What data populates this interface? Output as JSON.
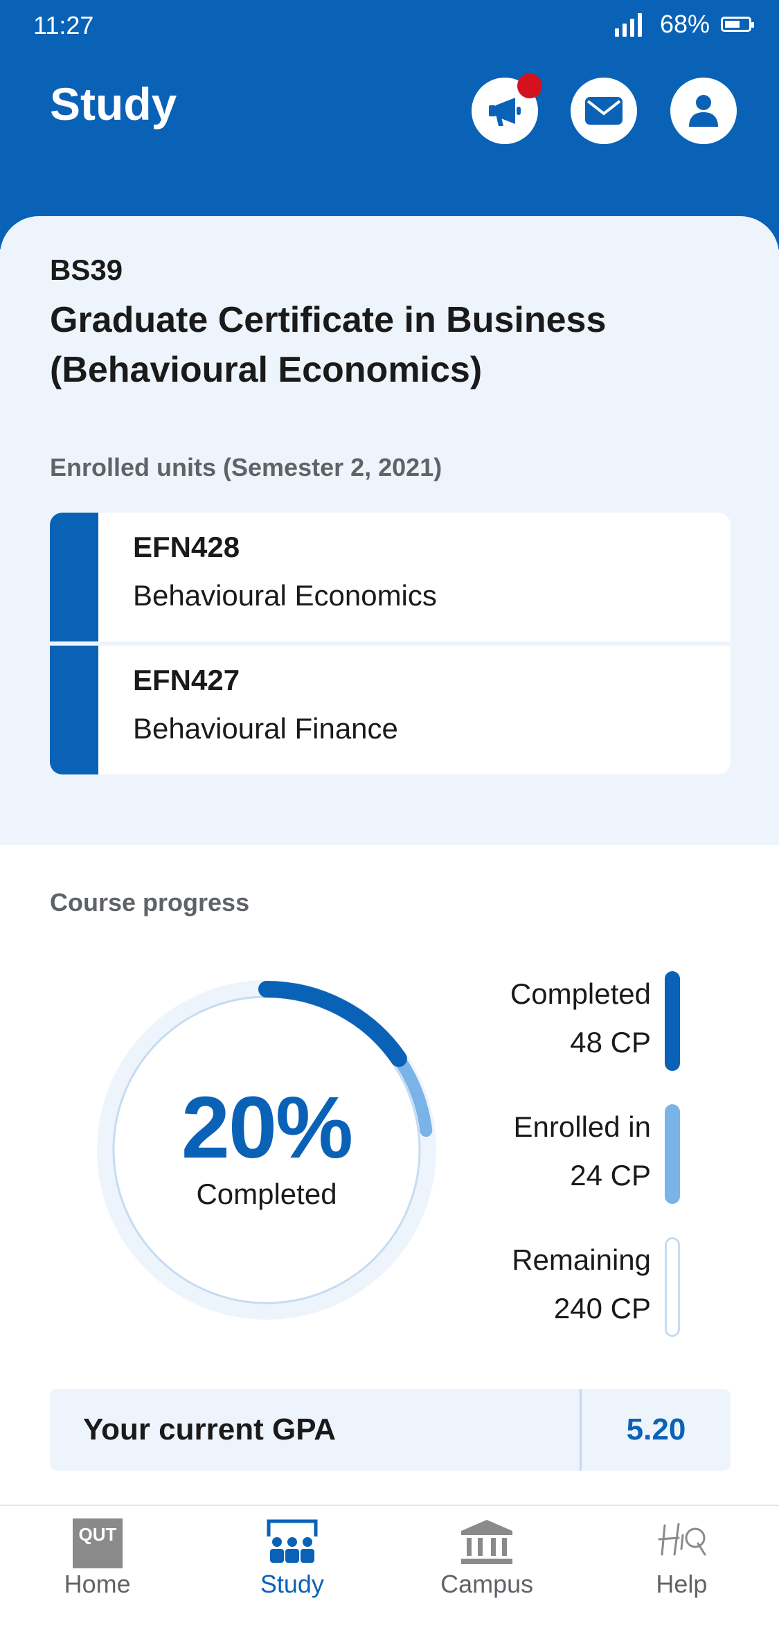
{
  "status_bar": {
    "time": "11:27",
    "battery": "68%"
  },
  "header": {
    "title": "Study",
    "icons": [
      "megaphone-icon",
      "mail-icon",
      "profile-icon"
    ]
  },
  "course": {
    "code": "BS39",
    "name": "Graduate Certificate in Business (Behavioural Economics)",
    "enrolled_heading": "Enrolled units (Semester 2, 2021)",
    "units": [
      {
        "code": "EFN428",
        "title": "Behavioural Economics"
      },
      {
        "code": "EFN427",
        "title": "Behavioural Finance"
      }
    ]
  },
  "progress": {
    "heading": "Course progress",
    "percent_label": "20%",
    "completed_label": "Completed",
    "completed_fraction": 0.1538,
    "enrolled_fraction": 0.0769,
    "legend": [
      {
        "label": "Completed",
        "value": "48 CP",
        "color": "#0a62b7"
      },
      {
        "label": "Enrolled in",
        "value": "24 CP",
        "color": "#7ab3e8"
      },
      {
        "label": "Remaining",
        "value": "240 CP",
        "color": "#eef4fb"
      }
    ]
  },
  "gpa": {
    "label": "Your current GPA",
    "value": "5.20"
  },
  "nav": [
    {
      "label": "Home",
      "icon": "qut-logo-icon",
      "active": false
    },
    {
      "label": "Study",
      "icon": "study-icon",
      "active": true
    },
    {
      "label": "Campus",
      "icon": "campus-icon",
      "active": false
    },
    {
      "label": "Help",
      "icon": "hiq-icon",
      "active": false
    }
  ],
  "colors": {
    "primary": "#0a62b7",
    "light_blue": "#7ab3e8",
    "panel": "#eef4fb",
    "alert": "#d4121e"
  }
}
